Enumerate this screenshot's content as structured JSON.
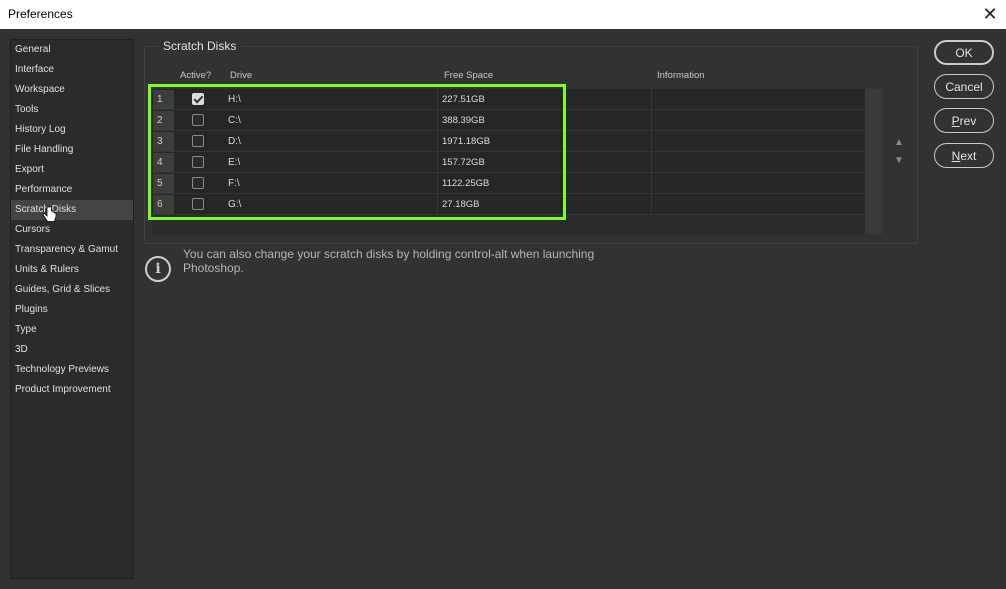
{
  "window": {
    "title": "Preferences",
    "close_glyph": "✕"
  },
  "sidebar": {
    "items": [
      {
        "label": "General"
      },
      {
        "label": "Interface"
      },
      {
        "label": "Workspace"
      },
      {
        "label": "Tools"
      },
      {
        "label": "History Log"
      },
      {
        "label": "File Handling"
      },
      {
        "label": "Export"
      },
      {
        "label": "Performance"
      },
      {
        "label": "Scratch Disks",
        "active": true
      },
      {
        "label": "Cursors"
      },
      {
        "label": "Transparency & Gamut"
      },
      {
        "label": "Units & Rulers"
      },
      {
        "label": "Guides, Grid & Slices"
      },
      {
        "label": "Plugins"
      },
      {
        "label": "Type"
      },
      {
        "label": "3D"
      },
      {
        "label": "Technology Previews"
      },
      {
        "label": "Product Improvement"
      }
    ]
  },
  "scratch": {
    "title": "Scratch Disks",
    "columns": {
      "active": "Active?",
      "drive": "Drive",
      "free": "Free Space",
      "info": "Information"
    },
    "rows": [
      {
        "num": "1",
        "active": true,
        "drive": "H:\\",
        "free": "227.51GB"
      },
      {
        "num": "2",
        "active": false,
        "drive": "C:\\",
        "free": "388.39GB"
      },
      {
        "num": "3",
        "active": false,
        "drive": "D:\\",
        "free": "1971.18GB"
      },
      {
        "num": "4",
        "active": false,
        "drive": "E:\\",
        "free": "157.72GB"
      },
      {
        "num": "5",
        "active": false,
        "drive": "F:\\",
        "free": "1122.25GB"
      },
      {
        "num": "6",
        "active": false,
        "drive": "G:\\",
        "free": "27.18GB"
      }
    ],
    "move_up_glyph": "▲",
    "move_down_glyph": "▼",
    "highlight_color": "#7cff1e"
  },
  "info": {
    "icon": "i",
    "text": "You can also change your scratch disks by holding control-alt when launching Photoshop."
  },
  "buttons": {
    "ok": "OK",
    "cancel": "Cancel",
    "prev": "Prev",
    "next": "Next"
  }
}
